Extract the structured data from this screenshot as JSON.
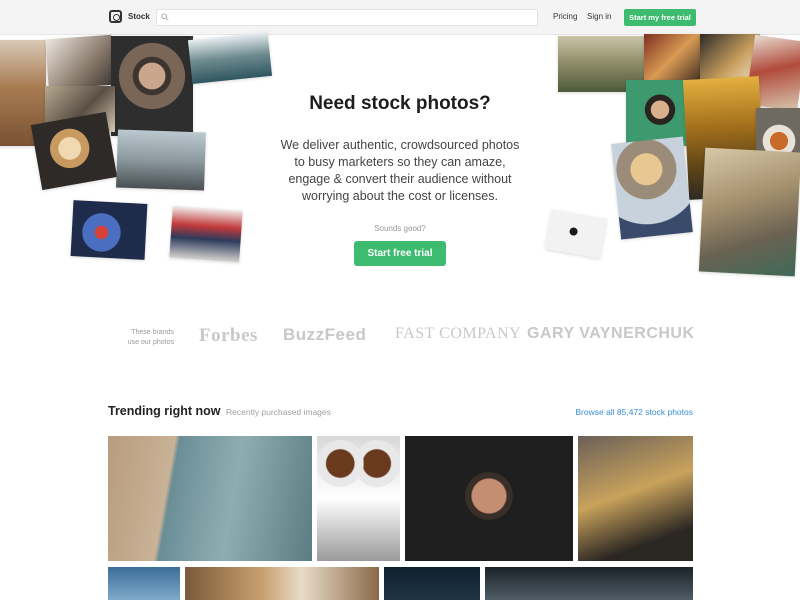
{
  "header": {
    "brand": "Stock",
    "search_placeholder": "",
    "nav": {
      "pricing": "Pricing",
      "sign_in": "Sign in"
    },
    "cta": "Start my free trial"
  },
  "hero": {
    "title": "Need stock photos?",
    "description_lines": [
      "We deliver authentic, crowdsourced photos",
      "to busy marketers so they can amaze,",
      "engage & convert their audience without",
      "worrying about the cost or licenses."
    ],
    "prompt": "Sounds good?",
    "cta": "Start free trial"
  },
  "brands": {
    "caption_lines": [
      "These brands",
      "use our photos"
    ],
    "logos": [
      "Forbes",
      "BuzzFeed",
      "FAST COMPANY",
      "GARY VAYNERCHUK"
    ]
  },
  "trending": {
    "title": "Trending right now",
    "subtitle": "Recently purchased images",
    "browse_link": "Browse all 85,472 stock photos"
  },
  "colors": {
    "accent": "#3dbb6e",
    "link": "#3a8fd8",
    "header_bg": "#f4f4f4"
  }
}
